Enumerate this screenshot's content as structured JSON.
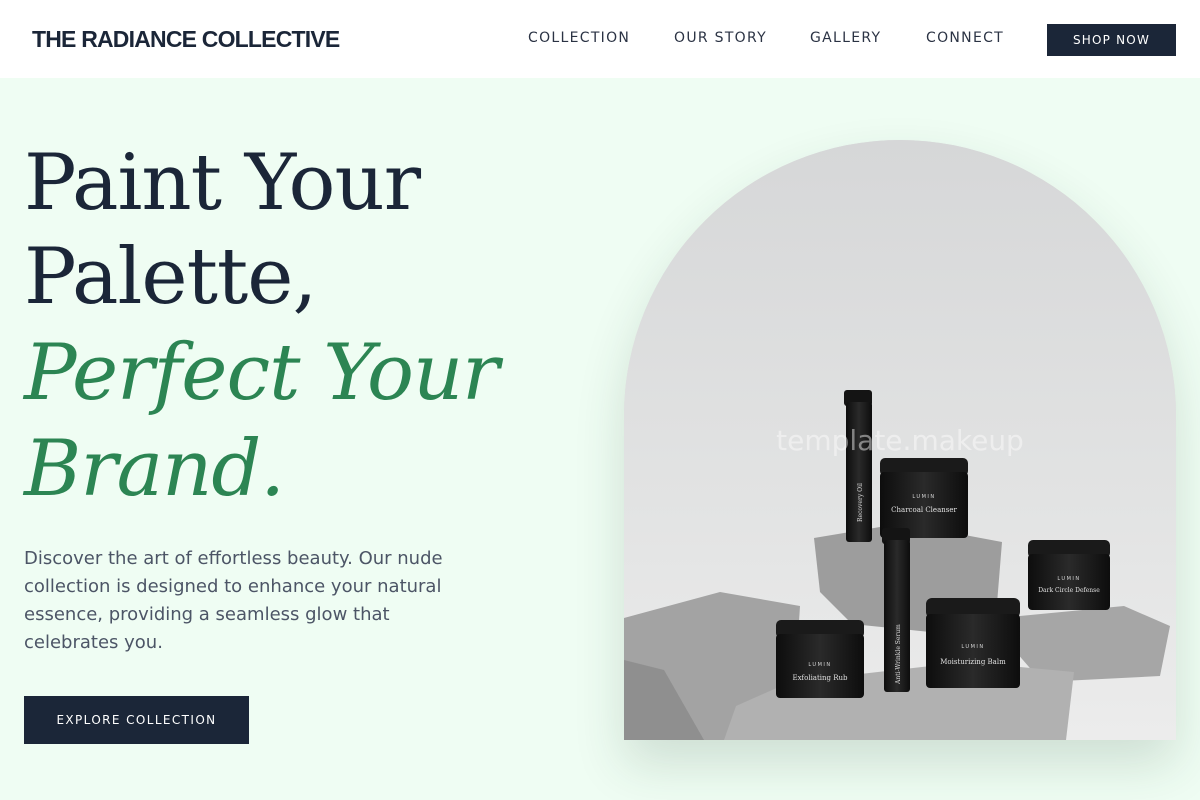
{
  "brand": {
    "logo_text": "THE RADIANCE COLLECTIVE"
  },
  "nav": {
    "items": [
      "COLLECTION",
      "OUR STORY",
      "GALLERY",
      "CONNECT"
    ],
    "cta_label": "SHOP NOW"
  },
  "hero": {
    "headline_lines": [
      "Paint Your",
      "Palette,",
      "Perfect Your",
      "Brand."
    ],
    "description": "Discover the art of effortless beauty. Our nude collection is designed to enhance your natural essence, providing a seamless glow that celebrates you.",
    "cta_label": "EXPLORE COLLECTION",
    "image": {
      "watermark": "template.makeup",
      "products": {
        "brand_mark": "LUMIN",
        "labels": [
          "Recovery Oil",
          "Charcoal Cleanser",
          "Anti-Wrinkle Serum",
          "Dark Circle Defense",
          "Moisturizing Balm",
          "Exfoliating Rub"
        ]
      }
    }
  },
  "colors": {
    "navy": "#1b2638",
    "accent_green": "#2c8553",
    "page_background": "#effdf3"
  }
}
